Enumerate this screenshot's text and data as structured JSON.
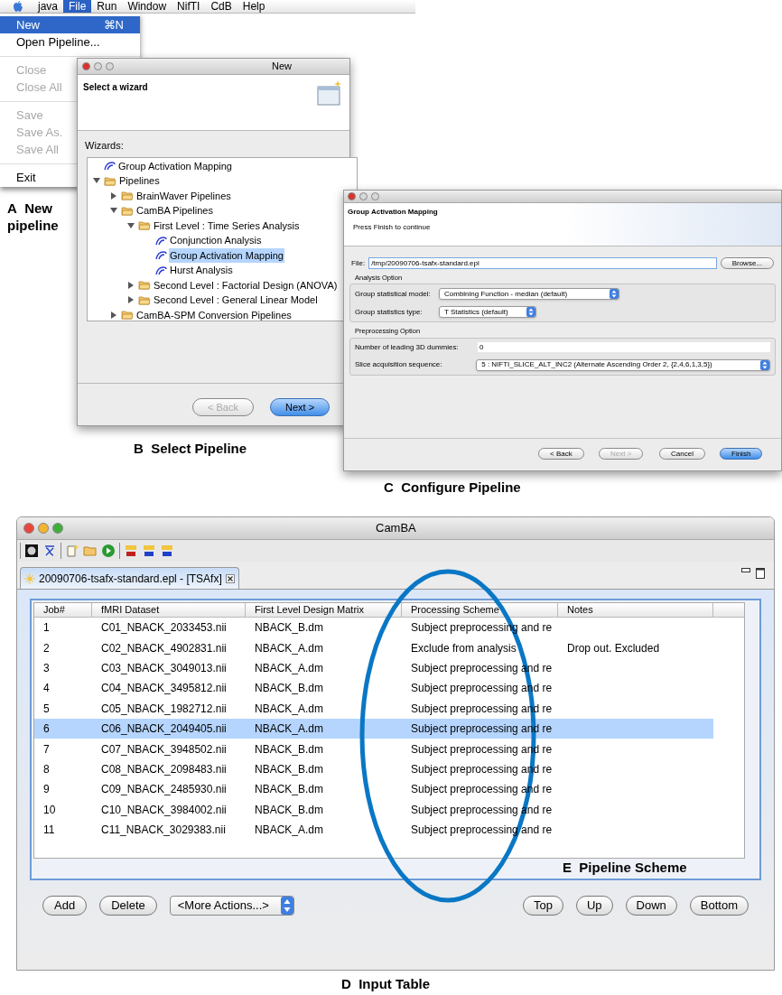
{
  "menu": {
    "bar": [
      {
        "label": "java",
        "selected": false
      },
      {
        "label": "File",
        "selected": true
      },
      {
        "label": "Run",
        "selected": false
      },
      {
        "label": "Window",
        "selected": false
      },
      {
        "label": "NifTI",
        "selected": false
      },
      {
        "label": "CdB",
        "selected": false
      },
      {
        "label": "Help",
        "selected": false
      }
    ],
    "items": [
      {
        "kind": "item",
        "label": "New",
        "shortcut": "⌘N",
        "selected": true,
        "disabled": false
      },
      {
        "kind": "item",
        "label": "Open Pipeline...",
        "selected": false,
        "disabled": false
      },
      {
        "kind": "separator"
      },
      {
        "kind": "item",
        "label": "Close",
        "selected": false,
        "disabled": true
      },
      {
        "kind": "item",
        "label": "Close All",
        "selected": false,
        "disabled": true
      },
      {
        "kind": "separator"
      },
      {
        "kind": "item",
        "label": "Save",
        "selected": false,
        "disabled": true
      },
      {
        "kind": "item",
        "label": "Save As.",
        "selected": false,
        "disabled": true
      },
      {
        "kind": "item",
        "label": "Save All",
        "selected": false,
        "disabled": true
      },
      {
        "kind": "separator"
      },
      {
        "kind": "item",
        "label": "Exit",
        "selected": false,
        "disabled": false
      }
    ],
    "caption_letter": "A",
    "caption": "New pipeline"
  },
  "wizard": {
    "title": "New",
    "heading": "Select a wizard",
    "list_label": "Wizards:",
    "tree": [
      {
        "kind": "wizard",
        "label": "Group Activation Mapping",
        "selected": false
      },
      {
        "kind": "folder",
        "label": "Pipelines",
        "expanded": true,
        "selected": false,
        "children": [
          {
            "kind": "folder",
            "label": "BrainWaver Pipelines",
            "expanded": false,
            "selected": false
          },
          {
            "kind": "folder",
            "label": "CamBA Pipelines",
            "expanded": true,
            "selected": false,
            "children": [
              {
                "kind": "folder",
                "label": "First Level : Time Series Analysis",
                "expanded": true,
                "selected": false,
                "children": [
                  {
                    "kind": "wizard",
                    "label": "Conjunction Analysis",
                    "selected": false
                  },
                  {
                    "kind": "wizard",
                    "label": "Group Activation Mapping",
                    "selected": true
                  },
                  {
                    "kind": "wizard",
                    "label": "Hurst Analysis",
                    "selected": false
                  }
                ]
              },
              {
                "kind": "folder",
                "label": "Second Level : Factorial Design (ANOVA)",
                "expanded": false,
                "selected": false
              },
              {
                "kind": "folder",
                "label": "Second Level : General Linear Model",
                "expanded": false,
                "selected": false
              }
            ]
          },
          {
            "kind": "folder",
            "label": "CamBA-SPM Conversion Pipelines",
            "expanded": false,
            "selected": false
          }
        ]
      }
    ],
    "buttons": [
      {
        "label": "< Back",
        "disabled": true,
        "default": false
      },
      {
        "label": "Next >",
        "disabled": false,
        "default": true
      }
    ],
    "caption_letter": "B",
    "caption": "Select Pipeline"
  },
  "config": {
    "heading": "Group Activation Mapping",
    "subheading": "Press Finish to continue",
    "file_label": "File:",
    "file_value": "/tmp/20090706-tsafx-standard.epl",
    "browse": "Browse...",
    "groups": [
      {
        "title": "Analysis Option",
        "fields": [
          {
            "kind": "select",
            "label": "Group statistical model:",
            "value": "Combining Function - median (default)"
          },
          {
            "kind": "select",
            "label": "Group statistics type:",
            "value": "T Statistics (default)"
          }
        ]
      },
      {
        "title": "Preprocessing Option",
        "fields": [
          {
            "kind": "text",
            "label": "Number of leading 3D dummies:",
            "value": "0"
          },
          {
            "kind": "select",
            "label": "Slice acquisition sequence:",
            "value": "5 : NIFTI_SLICE_ALT_INC2 (Alternate Ascending Order 2, {2,4,6,1,3,5})"
          }
        ]
      }
    ],
    "buttons": [
      {
        "label": "< Back",
        "disabled": false,
        "default": false
      },
      {
        "label": "Next >",
        "disabled": true,
        "default": false
      },
      {
        "label": "Cancel",
        "disabled": false,
        "default": false
      },
      {
        "label": "Finish",
        "disabled": false,
        "default": true
      }
    ],
    "caption_letter": "C",
    "caption": "Configure Pipeline"
  },
  "main": {
    "title": "CamBA",
    "tab": {
      "label": "20090706-tsafx-standard.epl - [TSAfx]",
      "selected": true
    },
    "columns": [
      "Job#",
      "fMRI Dataset",
      "First Level Design Matrix",
      "Processing Scheme",
      "Notes"
    ],
    "rows": [
      {
        "cells": [
          "1",
          "C01_NBACK_2033453.nii",
          "NBACK_B.dm",
          "Subject preprocessing and re",
          ""
        ],
        "selected": false
      },
      {
        "cells": [
          "2",
          "C02_NBACK_4902831.nii",
          "NBACK_A.dm",
          "Exclude from analysis",
          "Drop out. Excluded"
        ],
        "selected": false
      },
      {
        "cells": [
          "3",
          "C03_NBACK_3049013.nii",
          "NBACK_A.dm",
          "Subject preprocessing and re",
          ""
        ],
        "selected": false
      },
      {
        "cells": [
          "4",
          "C04_NBACK_3495812.nii",
          "NBACK_B.dm",
          "Subject preprocessing and re",
          ""
        ],
        "selected": false
      },
      {
        "cells": [
          "5",
          "C05_NBACK_1982712.nii",
          "NBACK_A.dm",
          "Subject preprocessing and re",
          ""
        ],
        "selected": false
      },
      {
        "cells": [
          "6",
          "C06_NBACK_2049405.nii",
          "NBACK_A.dm",
          "Subject preprocessing and re",
          ""
        ],
        "selected": true
      },
      {
        "cells": [
          "7",
          "C07_NBACK_3948502.nii",
          "NBACK_B.dm",
          "Subject preprocessing and re",
          ""
        ],
        "selected": false
      },
      {
        "cells": [
          "8",
          "C08_NBACK_2098483.nii",
          "NBACK_B.dm",
          "Subject preprocessing and re",
          ""
        ],
        "selected": false
      },
      {
        "cells": [
          "9",
          "C09_NBACK_2485930.nii",
          "NBACK_B.dm",
          "Subject preprocessing and re",
          ""
        ],
        "selected": false
      },
      {
        "cells": [
          "10",
          "C10_NBACK_3984002.nii",
          "NBACK_B.dm",
          "Subject preprocessing and re",
          ""
        ],
        "selected": false
      },
      {
        "cells": [
          "11",
          "C11_NBACK_3029383.nii",
          "NBACK_A.dm",
          "Subject preprocessing and re",
          ""
        ],
        "selected": false
      }
    ],
    "left_buttons": [
      "Add",
      "Delete"
    ],
    "actions_select": "<More Actions...>",
    "right_buttons": [
      "Top",
      "Up",
      "Down",
      "Bottom"
    ],
    "annotation_letter": "E",
    "annotation": "Pipeline Scheme",
    "caption_letter": "D",
    "caption": "Input Table"
  }
}
